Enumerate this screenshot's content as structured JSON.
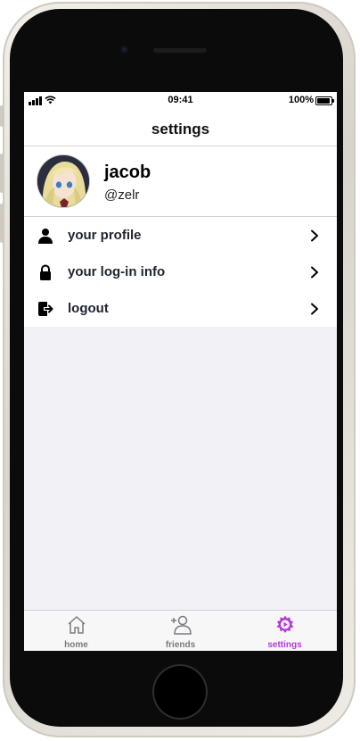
{
  "status_bar": {
    "time": "09:41",
    "battery": "100%"
  },
  "nav": {
    "title": "settings"
  },
  "profile": {
    "name": "jacob",
    "handle": "@zelr"
  },
  "menu": {
    "items": [
      {
        "label": "your profile",
        "icon": "person-icon"
      },
      {
        "label": "your log-in info",
        "icon": "lock-icon"
      },
      {
        "label": "logout",
        "icon": "logout-icon"
      }
    ]
  },
  "tabs": [
    {
      "label": "home",
      "icon": "house-icon"
    },
    {
      "label": "friends",
      "icon": "add-friend-icon"
    },
    {
      "label": "settings",
      "icon": "settings-gear-icon",
      "active": true
    }
  ],
  "colors": {
    "accent": "#b43ad6",
    "inactive_tab": "#7a7a80",
    "background": "#f2f1f5"
  }
}
